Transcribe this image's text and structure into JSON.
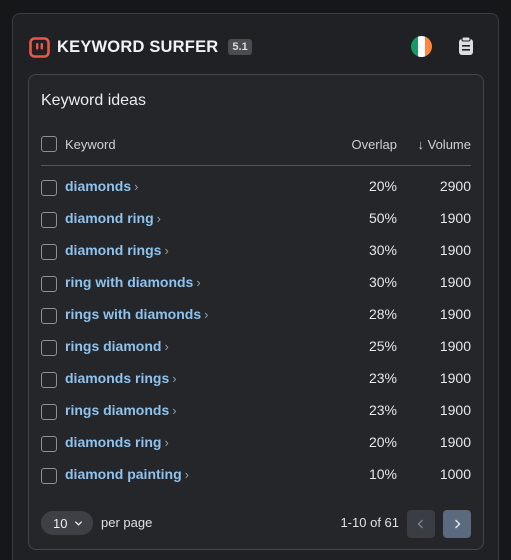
{
  "header": {
    "brand": "KEYWORD SURFER",
    "version": "5.1",
    "flag_colors": [
      "#169b62",
      "#ffffff",
      "#ff883e"
    ],
    "logo_color": "#e8584a",
    "icons": [
      "keyword-surfer-logo-icon",
      "ireland-flag-icon",
      "notepad-icon"
    ]
  },
  "card": {
    "title": "Keyword ideas",
    "columns": {
      "keyword": "Keyword",
      "overlap": "Overlap",
      "volume_arrow": "↓",
      "volume": "Volume"
    },
    "rows": [
      {
        "keyword": "diamonds",
        "overlap": "20%",
        "volume": "2900"
      },
      {
        "keyword": "diamond ring",
        "overlap": "50%",
        "volume": "1900"
      },
      {
        "keyword": "diamond rings",
        "overlap": "30%",
        "volume": "1900"
      },
      {
        "keyword": "ring with diamonds",
        "overlap": "30%",
        "volume": "1900"
      },
      {
        "keyword": "rings with diamonds",
        "overlap": "28%",
        "volume": "1900"
      },
      {
        "keyword": "rings diamond",
        "overlap": "25%",
        "volume": "1900"
      },
      {
        "keyword": "diamonds rings",
        "overlap": "23%",
        "volume": "1900"
      },
      {
        "keyword": "rings diamonds",
        "overlap": "23%",
        "volume": "1900"
      },
      {
        "keyword": "diamonds ring",
        "overlap": "20%",
        "volume": "1900"
      },
      {
        "keyword": "diamond painting",
        "overlap": "10%",
        "volume": "1000"
      }
    ],
    "chevron": "›"
  },
  "footer": {
    "page_size": "10",
    "per_page_label": "per page",
    "range": "1-10 of 61"
  },
  "colors": {
    "keyword_link": "#8fc2ec",
    "next_button": "#5c6a80",
    "prev_button": "#3b3d44"
  }
}
